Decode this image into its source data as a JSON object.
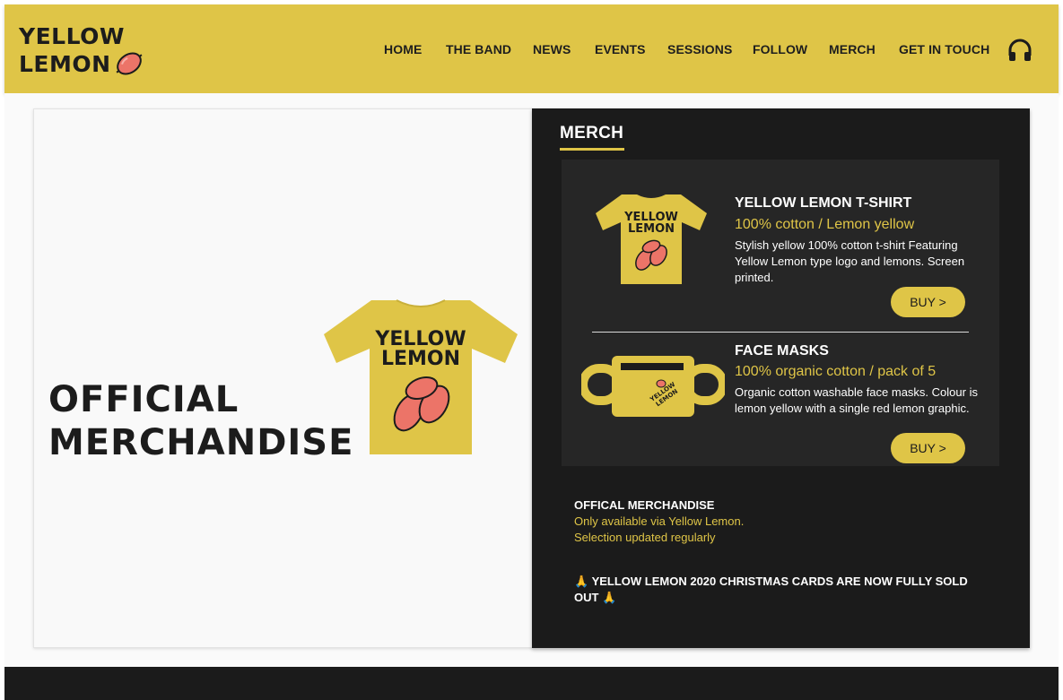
{
  "brand": {
    "logo_line1": "YELLOW",
    "logo_line2": "LEMON",
    "accent_color": "#dfc547",
    "lemon_color": "#ec7468",
    "dark_color": "#1b1b1b"
  },
  "nav": {
    "items": [
      {
        "label": "HOME"
      },
      {
        "label": "THE BAND"
      },
      {
        "label": "NEWS"
      },
      {
        "label": "EVENTS"
      },
      {
        "label": "SESSIONS"
      },
      {
        "label": "FOLLOW"
      },
      {
        "label": "MERCH"
      },
      {
        "label": "GET IN TOUCH"
      }
    ],
    "icon": "headphones-icon"
  },
  "hero": {
    "title_line1": "OFFICIAL",
    "title_line2": "MERCHANDISE",
    "shirt_text_line1": "YELLOW",
    "shirt_text_line2": "LEMON"
  },
  "panel": {
    "title": "MERCH",
    "products": [
      {
        "name": "YELLOW LEMON T-SHIRT",
        "subtitle": "100% cotton / Lemon yellow",
        "description": "Stylish yellow 100% cotton t-shirt Featuring Yellow Lemon type logo and lemons. Screen printed.",
        "buy_label": "BUY >",
        "image_text_line1": "YELLOW",
        "image_text_line2": "LEMON"
      },
      {
        "name": "FACE MASKS",
        "subtitle": "100% organic cotton / pack of 5",
        "description": "Organic cotton washable face masks. Colour is lemon yellow with a single red lemon graphic.",
        "buy_label": "BUY >",
        "image_text_line1": "YELLOW",
        "image_text_line2": "LEMON"
      }
    ],
    "info": {
      "heading": "OFFICAL MERCHANDISE",
      "line1": "Only available via Yellow Lemon.",
      "line2": "Selection updated regularly"
    },
    "notice": {
      "emoji": "🙏",
      "text": "YELLOW LEMON 2020 CHRISTMAS CARDS ARE NOW FULLY SOLD OUT"
    }
  }
}
